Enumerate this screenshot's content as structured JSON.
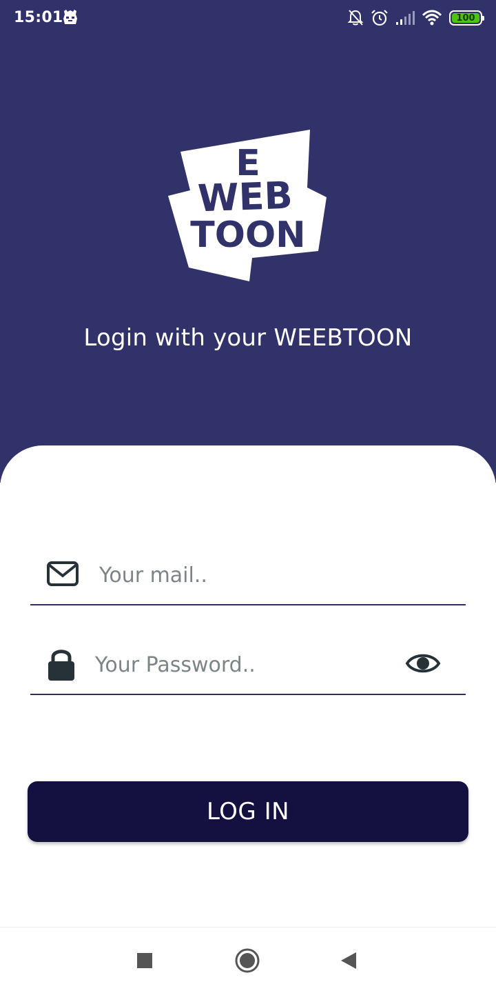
{
  "status_bar": {
    "time": "15:01",
    "battery": "100",
    "icons": [
      "game-controller-icon",
      "bell-off-icon",
      "alarm-icon",
      "signal-icon",
      "wifi-icon",
      "battery-icon"
    ]
  },
  "logo": {
    "line1": "E",
    "line2": "WEB",
    "line3": "TOON"
  },
  "header": {
    "subtitle": "Login with your WEEBTOON"
  },
  "form": {
    "email_placeholder": "Your mail..",
    "email_value": "",
    "password_placeholder": "Your Password..",
    "password_value": "",
    "login_label": "LOG IN"
  },
  "nav": {
    "icons": [
      "recent-apps-icon",
      "home-icon",
      "back-icon"
    ]
  },
  "colors": {
    "header_bg": "#31326a",
    "button_bg": "#141040",
    "underline": "#2c2d58",
    "placeholder": "#7b8588",
    "battery_fill": "#4cc414"
  }
}
